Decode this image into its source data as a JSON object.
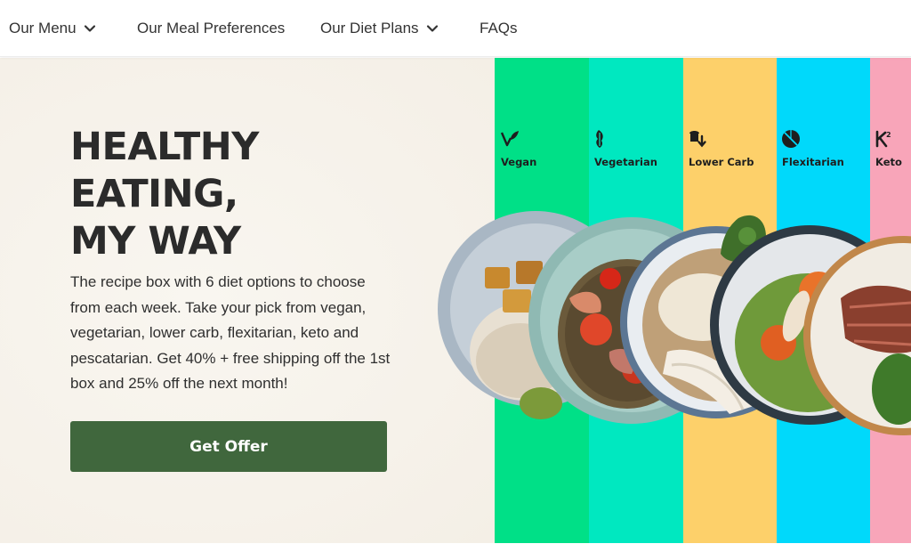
{
  "nav": {
    "items": [
      {
        "label": "Our Menu",
        "has_dropdown": true
      },
      {
        "label": "Our Meal Preferences",
        "has_dropdown": false
      },
      {
        "label": "Our Diet Plans",
        "has_dropdown": true
      },
      {
        "label": "FAQs",
        "has_dropdown": false
      }
    ]
  },
  "hero": {
    "headline": [
      "HEALTHY",
      "EATING,",
      "MY WAY"
    ],
    "subtext": "The recipe box with 6 diet options to choose from each week. Take your pick from vegan, vegetarian, lower carb, flexitarian, keto and pescatarian. Get 40% + free shipping off the 1st box and 25% off the next month!",
    "cta_label": "Get Offer"
  },
  "diets": [
    {
      "label": "Vegan",
      "icon": "leaf-v-icon",
      "color": "#00e087"
    },
    {
      "label": "Vegetarian",
      "icon": "vegetable-leaf-icon",
      "color": "#00e8c0"
    },
    {
      "label": "Lower Carb",
      "icon": "bread-arrow-down-icon",
      "color": "#fdd06a"
    },
    {
      "label": "Flexitarian",
      "icon": "half-circle-icon",
      "color": "#00d9fb"
    },
    {
      "label": "Keto",
      "icon": "keto-k-icon",
      "color": "#f8a5b9"
    }
  ],
  "colors": {
    "cta": "#40673d",
    "hero_bg": "#f7f3ec"
  }
}
